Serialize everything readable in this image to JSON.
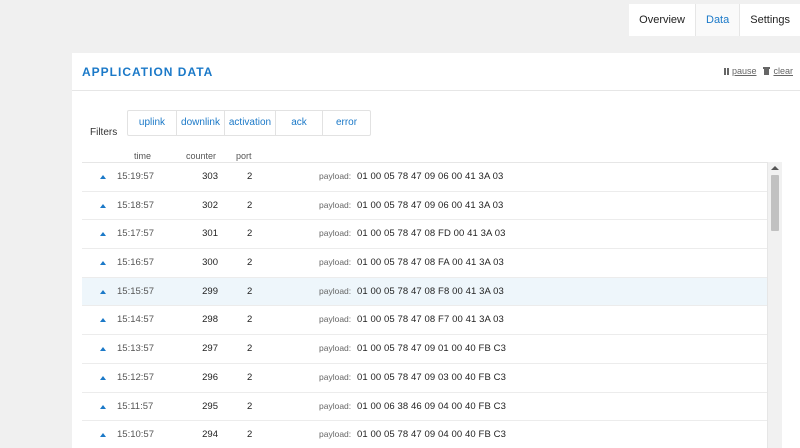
{
  "nav": {
    "tabs": [
      {
        "label": "Overview",
        "active": false
      },
      {
        "label": "Data",
        "active": true
      },
      {
        "label": "Settings",
        "active": false
      }
    ]
  },
  "panel": {
    "title": "APPLICATION DATA",
    "pause_label": "pause",
    "clear_label": "clear"
  },
  "filters": {
    "label": "Filters",
    "options": [
      "uplink",
      "downlink",
      "activation",
      "ack",
      "error"
    ]
  },
  "columns": {
    "time": "time",
    "counter": "counter",
    "port": "port"
  },
  "rows": [
    {
      "time": "15:19:57",
      "counter": "303",
      "port": "2",
      "payload_label": "payload:",
      "payload": "01 00 05 78 47 09 06 00 41 3A 03"
    },
    {
      "time": "15:18:57",
      "counter": "302",
      "port": "2",
      "payload_label": "payload:",
      "payload": "01 00 05 78 47 09 06 00 41 3A 03"
    },
    {
      "time": "15:17:57",
      "counter": "301",
      "port": "2",
      "payload_label": "payload:",
      "payload": "01 00 05 78 47 08 FD 00 41 3A 03"
    },
    {
      "time": "15:16:57",
      "counter": "300",
      "port": "2",
      "payload_label": "payload:",
      "payload": "01 00 05 78 47 08 FA 00 41 3A 03"
    },
    {
      "time": "15:15:57",
      "counter": "299",
      "port": "2",
      "payload_label": "payload:",
      "payload": "01 00 05 78 47 08 F8 00 41 3A 03"
    },
    {
      "time": "15:14:57",
      "counter": "298",
      "port": "2",
      "payload_label": "payload:",
      "payload": "01 00 05 78 47 08 F7 00 41 3A 03"
    },
    {
      "time": "15:13:57",
      "counter": "297",
      "port": "2",
      "payload_label": "payload:",
      "payload": "01 00 05 78 47 09 01 00 40 FB C3"
    },
    {
      "time": "15:12:57",
      "counter": "296",
      "port": "2",
      "payload_label": "payload:",
      "payload": "01 00 05 78 47 09 03 00 40 FB C3"
    },
    {
      "time": "15:11:57",
      "counter": "295",
      "port": "2",
      "payload_label": "payload:",
      "payload": "01 00 06 38 46 09 04 00 40 FB C3"
    },
    {
      "time": "15:10:57",
      "counter": "294",
      "port": "2",
      "payload_label": "payload:",
      "payload": "01 00 05 78 47 09 04 00 40 FB C3"
    }
  ],
  "highlighted_row": 4,
  "colors": {
    "accent": "#1b79c8",
    "row_highlight": "#eef6fb",
    "background": "#f0f0f0"
  }
}
